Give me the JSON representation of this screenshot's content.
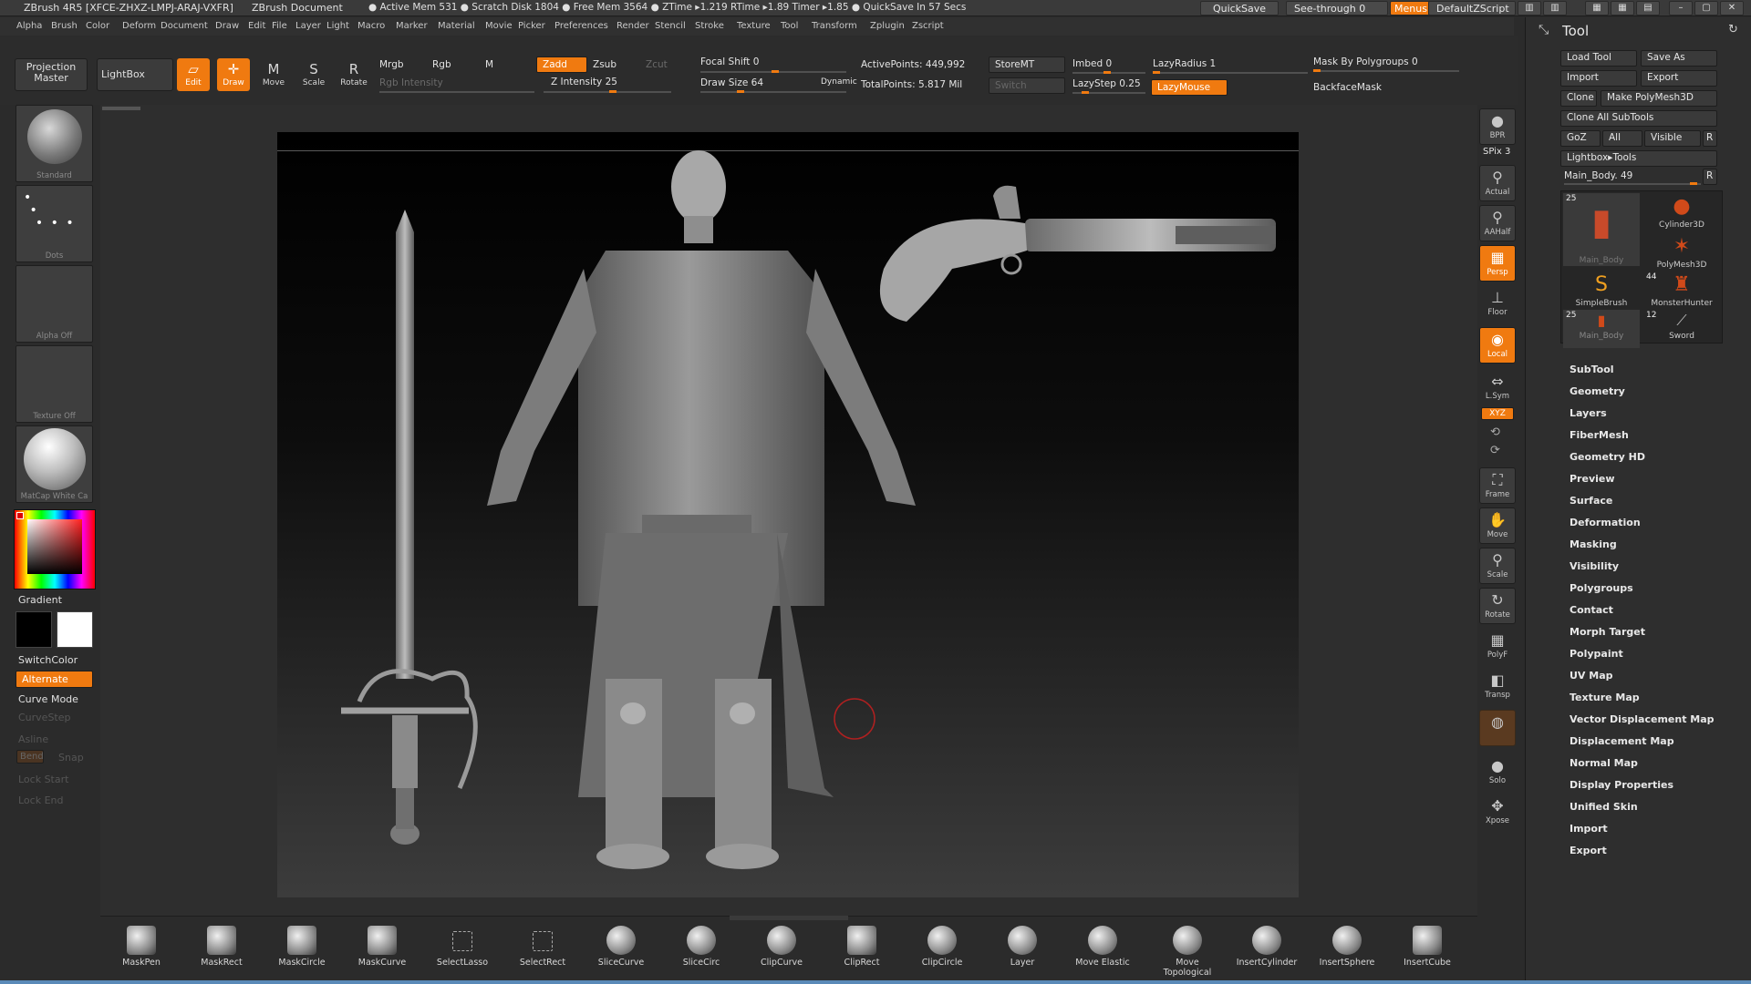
{
  "titlebar": {
    "app": "ZBrush 4R5 [XFCE-ZHXZ-LMPJ-ARAJ-VXFR]",
    "document": "ZBrush Document",
    "stats": "● Active Mem 531 ● Scratch Disk 1804 ● Free Mem 3564 ● ZTime ▸1.219 RTime ▸1.89 Timer ▸1.85 ● QuickSave In 57 Secs",
    "quicksave": "QuickSave",
    "see_through": "See-through   0",
    "menus": "Menus",
    "script": "DefaultZScript"
  },
  "menubar": [
    "Alpha",
    "Brush",
    "Color",
    "Deform",
    "Document",
    "Draw",
    "Edit",
    "File",
    "Layer",
    "Light",
    "Macro",
    "Marker",
    "Material",
    "Movie",
    "Picker",
    "Preferences",
    "Render",
    "Stencil",
    "Stroke",
    "Texture",
    "Tool",
    "Transform",
    "Zplugin",
    "Zscript"
  ],
  "shelf": {
    "projection_master": "Projection Master",
    "lightbox": "LightBox",
    "edit": "Edit",
    "draw": "Draw",
    "move": "Move",
    "scale": "Scale",
    "rotate": "Rotate",
    "mrgb": "Mrgb",
    "rgb": "Rgb",
    "m": "M",
    "rgb_intensity": "Rgb Intensity",
    "zadd": "Zadd",
    "zsub": "Zsub",
    "zcut": "Zcut",
    "z_intensity": "Z Intensity 25",
    "focal_shift": "Focal Shift 0",
    "draw_size": "Draw Size 64",
    "dynamic": "Dynamic",
    "active_points": "ActivePoints: 449,992",
    "total_points": "TotalPoints: 5.817 Mil",
    "storemt": "StoreMT",
    "switch": "Switch",
    "imbed": "Imbed 0",
    "lazystep": "LazyStep 0.25",
    "lazyradius": "LazyRadius 1",
    "lazymouse": "LazyMouse",
    "mask_by_polygroups": "Mask By Polygroups 0",
    "backfacemask": "BackfaceMask"
  },
  "left": {
    "brush": "Standard",
    "stroke": "Dots",
    "alpha": "Alpha Off",
    "texture": "Texture Off",
    "material": "MatCap White Ca",
    "gradient": "Gradient",
    "switchcolor": "SwitchColor",
    "alternate": "Alternate",
    "curve_mode": "Curve Mode",
    "curvestep": "CurveStep",
    "asline": "Asline",
    "bend": "Bend",
    "snap": "Snap",
    "lock_start": "Lock Start",
    "lock_end": "Lock End"
  },
  "right_toolbar": [
    {
      "icon": "bpr-icon",
      "label": "BPR"
    },
    {
      "icon": "spix-label",
      "label": "SPix 3"
    },
    {
      "icon": "actual-icon",
      "label": "Actual"
    },
    {
      "icon": "aahalf-icon",
      "label": "AAHalf"
    },
    {
      "icon": "persp-icon",
      "label": "Persp"
    },
    {
      "icon": "floor-icon",
      "label": "Floor"
    },
    {
      "icon": "local-icon",
      "label": "Local"
    },
    {
      "icon": "lsym-icon",
      "label": "L.Sym"
    },
    {
      "icon": "xyz-icon",
      "label": "XYZ"
    },
    {
      "icon": "frame-icon",
      "label": "Frame"
    },
    {
      "icon": "move-icon",
      "label": "Move"
    },
    {
      "icon": "scale-icon",
      "label": "Scale"
    },
    {
      "icon": "rotate-icon",
      "label": "Rotate"
    },
    {
      "icon": "polyf-icon",
      "label": "PolyF"
    },
    {
      "icon": "transp-icon",
      "label": "Transp"
    },
    {
      "icon": "solo-icon",
      "label": "Solo"
    },
    {
      "icon": "xpose-icon",
      "label": "Xpose"
    }
  ],
  "tool": {
    "title": "Tool",
    "load_tool": "Load Tool",
    "save_as": "Save As",
    "import": "Import",
    "export": "Export",
    "clone": "Clone",
    "make_polymesh": "Make PolyMesh3D",
    "clone_all": "Clone All SubTools",
    "goz": "GoZ",
    "all": "All",
    "visible": "Visible",
    "r": "R",
    "lightbox_tools": "Lightbox▸Tools",
    "main_body": "Main_Body. 49",
    "thumbs": [
      {
        "name": "Main_Body",
        "num": "25"
      },
      {
        "name": "Cylinder3D",
        "num": ""
      },
      {
        "name": "PolyMesh3D",
        "num": ""
      },
      {
        "name": "SimpleBrush",
        "num": ""
      },
      {
        "name": "MonsterHunter",
        "num": "44"
      },
      {
        "name": "Main_Body",
        "num": "25"
      },
      {
        "name": "Sword",
        "num": "12"
      }
    ],
    "menus": [
      "SubTool",
      "Geometry",
      "Layers",
      "FiberMesh",
      "Geometry HD",
      "Preview",
      "Surface",
      "Deformation",
      "Masking",
      "Visibility",
      "Polygroups",
      "Contact",
      "Morph Target",
      "Polypaint",
      "UV Map",
      "Texture Map",
      "Vector Displacement Map",
      "Displacement Map",
      "Normal Map",
      "Display Properties",
      "Unified Skin",
      "Import",
      "Export"
    ]
  },
  "bottom": [
    "MaskPen",
    "MaskRect",
    "MaskCircle",
    "MaskCurve",
    "SelectLasso",
    "SelectRect",
    "SliceCurve",
    "SliceCirc",
    "ClipCurve",
    "ClipRect",
    "ClipCircle",
    "Layer",
    "Move Elastic",
    "Move Topological",
    "InsertCylinder",
    "InsertSphere",
    "InsertCube"
  ],
  "colors": {
    "accent": "#f07a10",
    "panel": "#2b2b2b",
    "status": "#5a8ab8"
  }
}
